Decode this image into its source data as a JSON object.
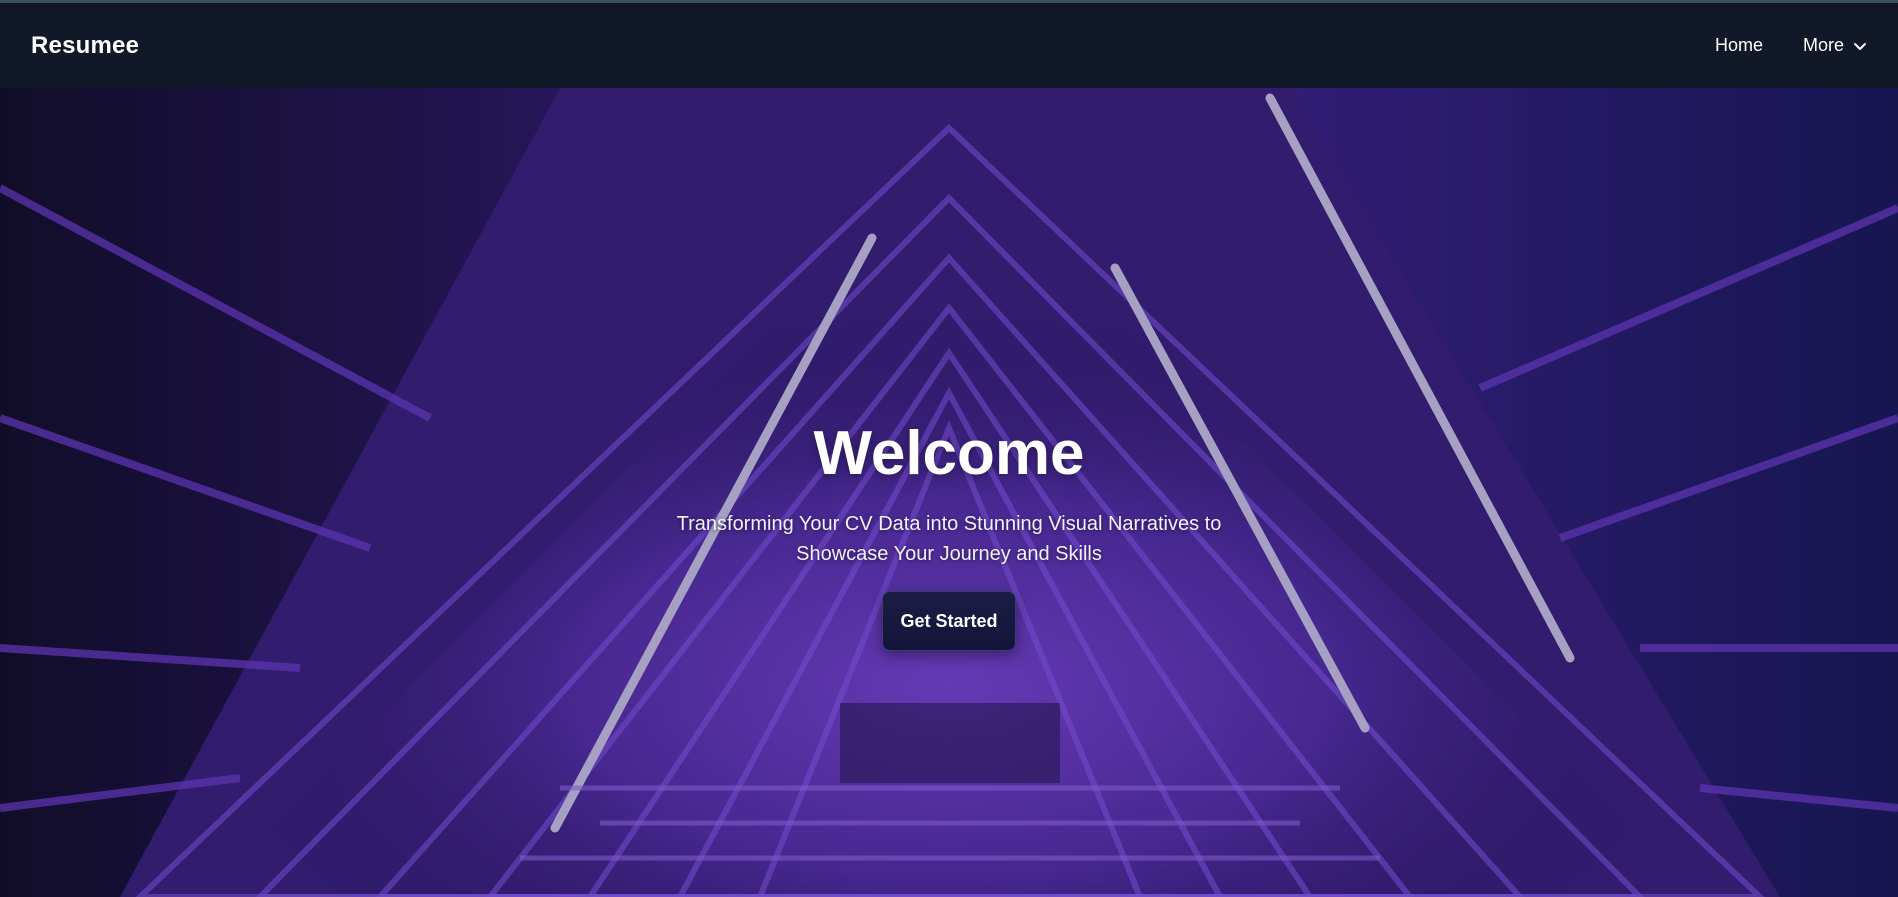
{
  "navbar": {
    "brand": "Resumee",
    "links": [
      {
        "label": "Home"
      },
      {
        "label": "More",
        "icon": "chevron-down-icon"
      }
    ]
  },
  "hero": {
    "title": "Welcome",
    "subtitle": "Transforming Your CV Data into Stunning Visual Narratives to Showcase Your Journey and Skills",
    "cta_label": "Get Started",
    "background": "purple neon triangular stairwell photo"
  },
  "colors": {
    "navbar_bg": "#111827",
    "hero_purple": "#5a2ea6",
    "button_bg": "#1b1d44"
  }
}
